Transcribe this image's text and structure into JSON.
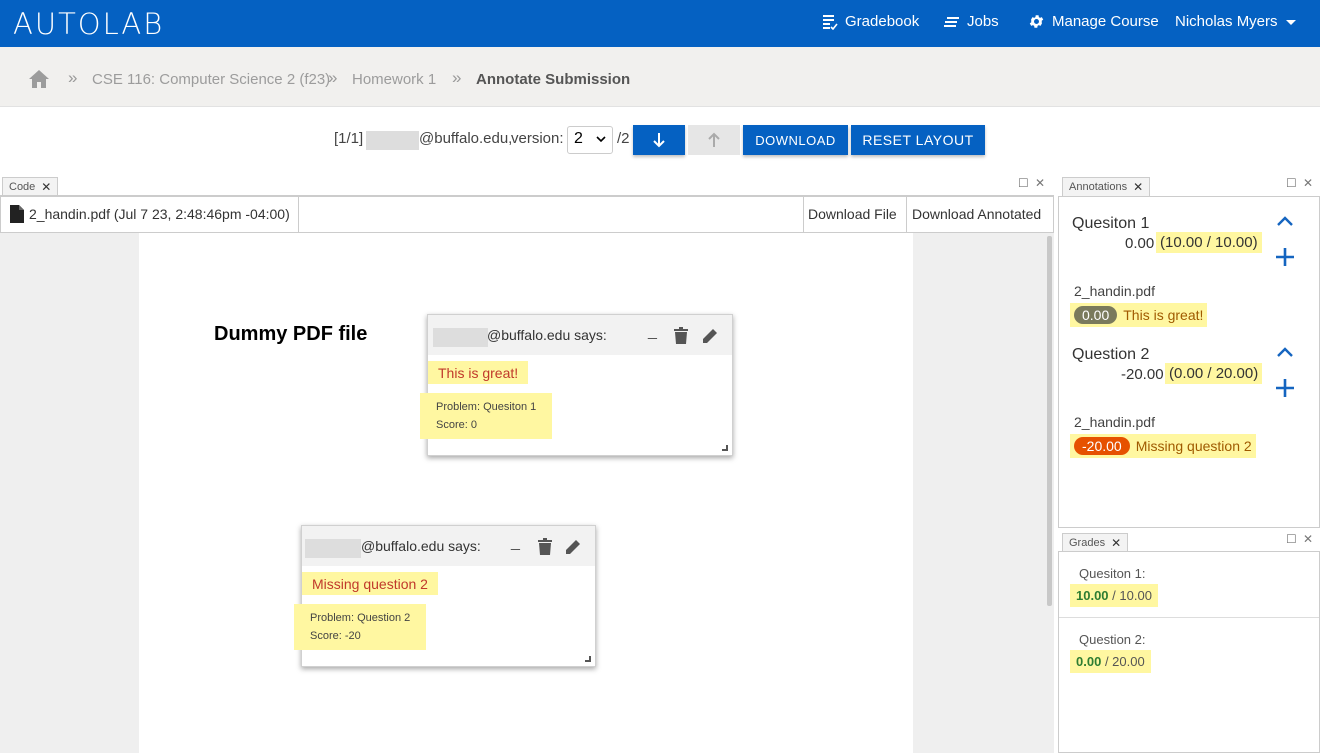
{
  "brand": {
    "logo": "AUTOLAB"
  },
  "nav": {
    "gradebook": "Gradebook",
    "jobs": "Jobs",
    "manage_course": "Manage Course",
    "user": "Nicholas Myers"
  },
  "breadcrumb": {
    "course": "CSE 116: Computer Science 2 (f23)",
    "assessment": "Homework 1",
    "current": "Annotate Submission"
  },
  "toolbar": {
    "index": "[1/1]",
    "email_domain": "@buffalo.edu,",
    "version_label": "version:",
    "version_value": "2",
    "version_total": "/2",
    "download_label": "DOWNLOAD",
    "reset_label": "RESET LAYOUT"
  },
  "code_panel": {
    "tab_label": "Code",
    "file_name": "2_handin.pdf (Jul 7 23, 2:48:46pm -04:00)",
    "download_file": "Download File",
    "download_annotated": "Download Annotated",
    "pdf_title": "Dummy PDF file"
  },
  "popups": [
    {
      "says": "@buffalo.edu says:",
      "comment": "This is great!",
      "problem": "Problem: Quesiton 1",
      "score": "Score: 0"
    },
    {
      "says": "@buffalo.edu says:",
      "comment": "Missing question 2",
      "problem": "Problem: Question 2",
      "score": "Score: -20"
    }
  ],
  "annotations_panel": {
    "tab_label": "Annotations",
    "questions": [
      {
        "title": "Quesiton 1",
        "delta": "0.00",
        "score": "(10.00 / 10.00)",
        "file": "2_handin.pdf",
        "pill": "0.00",
        "comment": "This is great!"
      },
      {
        "title": "Question 2",
        "delta": "-20.00",
        "score": "(0.00 / 20.00)",
        "file": "2_handin.pdf",
        "pill": "-20.00",
        "comment": "Missing question 2"
      }
    ]
  },
  "grades_panel": {
    "tab_label": "Grades",
    "items": [
      {
        "label": "Quesiton 1:",
        "score": "10.00",
        "max": "/ 10.00"
      },
      {
        "label": "Question 2:",
        "score": "0.00",
        "max": "/ 20.00"
      }
    ]
  },
  "colors": {
    "nav_blue": "#0561c2",
    "highlight": "#fff7a1",
    "negative_pill": "#e65100",
    "positive_score": "#2e7d32"
  }
}
